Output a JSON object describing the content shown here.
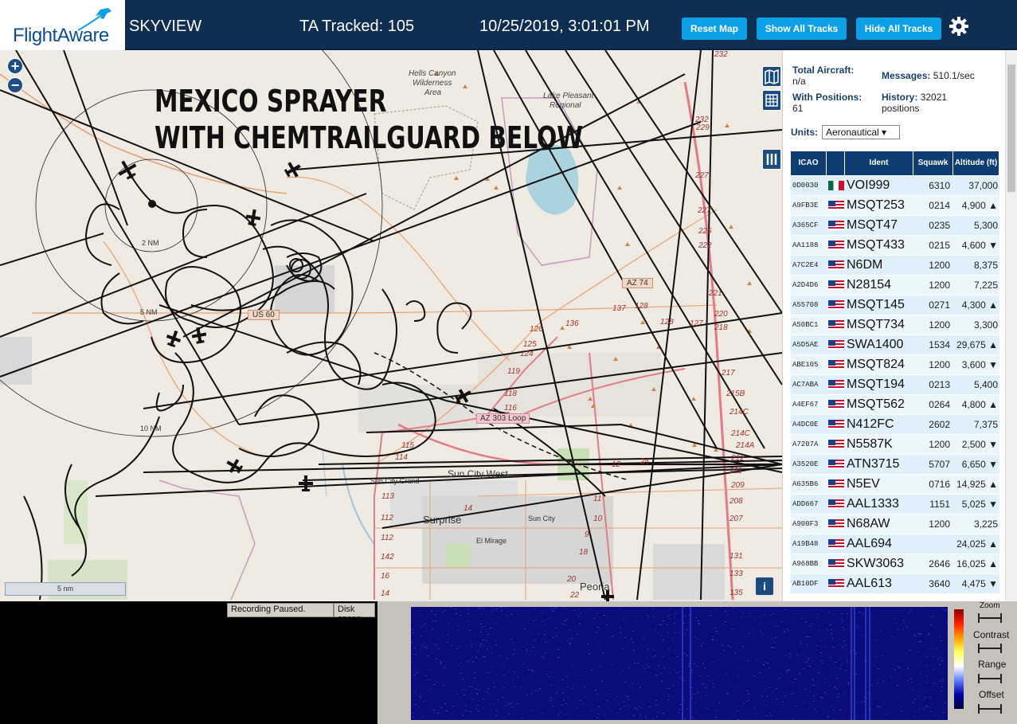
{
  "header": {
    "logo": "FlightAware",
    "app_name": "SKYVIEW",
    "tracked": "TA Tracked: 105",
    "datetime": "10/25/2019, 3:01:01 PM",
    "buttons": {
      "reset": "Reset Map",
      "show": "Show All Tracks",
      "hide": "Hide All Tracks"
    },
    "accent": "#0ea0e6",
    "bar_color": "#0e2e52"
  },
  "map": {
    "overlay_line1": "MEXICO SPRAYER",
    "overlay_line2": "WITH CHEMTRAILGUARD BELOW",
    "zoom_in": "+",
    "zoom_out": "−",
    "scale_label": "5 nm",
    "info": "i",
    "labels": {
      "hells_canyon": "Hells Canyon",
      "wilderness": "Wilderness",
      "area": "Area",
      "lake_pleasant": "Lake Pleasant",
      "regional_park": "Regional",
      "us60": "US 60",
      "az74": "AZ 74",
      "az303": "AZ 303 Loop",
      "sun_city_west": "Sun City West",
      "sun_city_grand": "Sun City Grand",
      "surprise": "Surprise",
      "sun_city": "Sun City",
      "el_mirage": "El Mirage",
      "peoria": "Peoria",
      "nm2": "2 NM",
      "nm5": "5 NM",
      "nm10": "10 NM"
    },
    "route_numbers": [
      "232",
      "232",
      "229",
      "227",
      "227",
      "225",
      "222",
      "221",
      "220",
      "218",
      "217",
      "215B",
      "214C",
      "214C",
      "214A",
      "212",
      "211",
      "209",
      "208",
      "207",
      "131",
      "133",
      "135",
      "136",
      "137",
      "128",
      "128",
      "127",
      "126",
      "125",
      "124",
      "119",
      "118",
      "116",
      "115",
      "114",
      "113",
      "112",
      "112",
      "142",
      "16",
      "14",
      "14",
      "12",
      "11",
      "10",
      "9",
      "18",
      "20",
      "22",
      "24"
    ]
  },
  "panel": {
    "total_aircraft_label": "Total Aircraft:",
    "total_aircraft_value": "n/a",
    "with_positions_label": "With Positions:",
    "with_positions_value": "61",
    "messages_label": "Messages:",
    "messages_value": "510.1/sec",
    "history_label": "History:",
    "history_value": "32021",
    "history_unit": "positions",
    "units_label": "Units:",
    "units_value": "Aeronautical ▾",
    "columns": [
      "ICAO",
      "",
      "Ident",
      "Squawk",
      "Altitude (ft)"
    ],
    "rows": [
      {
        "icao": "0D0030",
        "flag": "mx",
        "ident": "VOI999",
        "squawk": "6310",
        "alt": "37,000"
      },
      {
        "icao": "A9FB3E",
        "flag": "us",
        "ident": "MSQT253",
        "squawk": "0214",
        "alt": "4,900 ▲"
      },
      {
        "icao": "A365CF",
        "flag": "us",
        "ident": "MSQT47",
        "squawk": "0235",
        "alt": "5,300"
      },
      {
        "icao": "AA1188",
        "flag": "us",
        "ident": "MSQT433",
        "squawk": "0215",
        "alt": "4,600 ▼"
      },
      {
        "icao": "A7C2E4",
        "flag": "us",
        "ident": "N6DM",
        "squawk": "1200",
        "alt": "8,375"
      },
      {
        "icao": "A2D4D6",
        "flag": "us",
        "ident": "N28154",
        "squawk": "1200",
        "alt": "7,225"
      },
      {
        "icao": "A55708",
        "flag": "us",
        "ident": "MSQT145",
        "squawk": "0271",
        "alt": "4,300 ▲"
      },
      {
        "icao": "A50BC1",
        "flag": "us",
        "ident": "MSQT734",
        "squawk": "1200",
        "alt": "3,300"
      },
      {
        "icao": "A5D5AE",
        "flag": "us",
        "ident": "SWA1400",
        "squawk": "1534",
        "alt": "29,675 ▲"
      },
      {
        "icao": "ABE105",
        "flag": "us",
        "ident": "MSQT824",
        "squawk": "1200",
        "alt": "3,600 ▼"
      },
      {
        "icao": "AC7ABA",
        "flag": "us",
        "ident": "MSQT194",
        "squawk": "0213",
        "alt": "5,400"
      },
      {
        "icao": "A4EF67",
        "flag": "us",
        "ident": "MSQT562",
        "squawk": "0264",
        "alt": "4,800 ▲"
      },
      {
        "icao": "A4DC0E",
        "flag": "us",
        "ident": "N412FC",
        "squawk": "2602",
        "alt": "7,375"
      },
      {
        "icao": "A7207A",
        "flag": "us",
        "ident": "N5587K",
        "squawk": "1200",
        "alt": "2,500 ▼"
      },
      {
        "icao": "A3520E",
        "flag": "us",
        "ident": "ATN3715",
        "squawk": "5707",
        "alt": "6,650 ▼"
      },
      {
        "icao": "A635B6",
        "flag": "us",
        "ident": "N5EV",
        "squawk": "0716",
        "alt": "14,925 ▲"
      },
      {
        "icao": "ADD667",
        "flag": "us",
        "ident": "AAL1333",
        "squawk": "1151",
        "alt": "5,025 ▼"
      },
      {
        "icao": "A900F3",
        "flag": "us",
        "ident": "N68AW",
        "squawk": "1200",
        "alt": "3,225"
      },
      {
        "icao": "A19B48",
        "flag": "us",
        "ident": "AAL694",
        "squawk": "",
        "alt": "24,025 ▲"
      },
      {
        "icao": "A968BB",
        "flag": "us",
        "ident": "SKW3063",
        "squawk": "2646",
        "alt": "16,025 ▲"
      },
      {
        "icao": "AB10DF",
        "flag": "us",
        "ident": "AAL613",
        "squawk": "3640",
        "alt": "4,475 ▼"
      }
    ]
  },
  "desktop": {
    "status_left": "Recording Paused.",
    "status_right": "Disk space",
    "controls": [
      "Zoom",
      "Contrast",
      "Range",
      "Offset"
    ]
  }
}
